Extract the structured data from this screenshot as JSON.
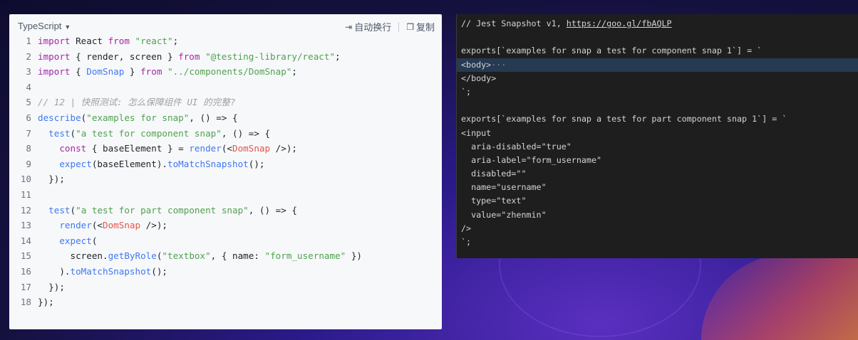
{
  "left_panel": {
    "language": "TypeScript",
    "wrap_label": "自动换行",
    "copy_label": "复制",
    "lines": [
      {
        "n": "1",
        "tokens": [
          {
            "t": "kw",
            "v": "import "
          },
          {
            "t": "tx",
            "v": "React "
          },
          {
            "t": "kw",
            "v": "from "
          },
          {
            "t": "str",
            "v": "\"react\""
          },
          {
            "t": "tx",
            "v": ";"
          }
        ]
      },
      {
        "n": "2",
        "tokens": [
          {
            "t": "kw",
            "v": "import "
          },
          {
            "t": "tx",
            "v": "{ render, screen } "
          },
          {
            "t": "kw",
            "v": "from "
          },
          {
            "t": "str",
            "v": "\"@testing-library/react\""
          },
          {
            "t": "tx",
            "v": ";"
          }
        ]
      },
      {
        "n": "3",
        "tokens": [
          {
            "t": "kw",
            "v": "import "
          },
          {
            "t": "tx",
            "v": "{ "
          },
          {
            "t": "fn",
            "v": "DomSnap"
          },
          {
            "t": "tx",
            "v": " } "
          },
          {
            "t": "kw",
            "v": "from "
          },
          {
            "t": "str",
            "v": "\"../components/DomSnap\""
          },
          {
            "t": "tx",
            "v": ";"
          }
        ]
      },
      {
        "n": "4",
        "tokens": []
      },
      {
        "n": "5",
        "tokens": [
          {
            "t": "cmt",
            "v": "// 12 | 快照测试: 怎么保障组件 UI 的完整?"
          }
        ]
      },
      {
        "n": "6",
        "tokens": [
          {
            "t": "fn",
            "v": "describe"
          },
          {
            "t": "tx",
            "v": "("
          },
          {
            "t": "str",
            "v": "\"examples for snap\""
          },
          {
            "t": "tx",
            "v": ", () => {"
          }
        ]
      },
      {
        "n": "7",
        "tokens": [
          {
            "t": "tx",
            "v": "  "
          },
          {
            "t": "fn",
            "v": "test"
          },
          {
            "t": "tx",
            "v": "("
          },
          {
            "t": "str",
            "v": "\"a test for component snap\""
          },
          {
            "t": "tx",
            "v": ", () => {"
          }
        ]
      },
      {
        "n": "8",
        "tokens": [
          {
            "t": "tx",
            "v": "    "
          },
          {
            "t": "kw",
            "v": "const "
          },
          {
            "t": "tx",
            "v": "{ baseElement } = "
          },
          {
            "t": "fn",
            "v": "render"
          },
          {
            "t": "tx",
            "v": "(<"
          },
          {
            "t": "tag",
            "v": "DomSnap"
          },
          {
            "t": "tx",
            "v": " />);"
          }
        ]
      },
      {
        "n": "9",
        "tokens": [
          {
            "t": "tx",
            "v": "    "
          },
          {
            "t": "fn",
            "v": "expect"
          },
          {
            "t": "tx",
            "v": "(baseElement)."
          },
          {
            "t": "fn",
            "v": "toMatchSnapshot"
          },
          {
            "t": "tx",
            "v": "();"
          }
        ]
      },
      {
        "n": "10",
        "tokens": [
          {
            "t": "tx",
            "v": "  });"
          }
        ]
      },
      {
        "n": "11",
        "tokens": []
      },
      {
        "n": "12",
        "tokens": [
          {
            "t": "tx",
            "v": "  "
          },
          {
            "t": "fn",
            "v": "test"
          },
          {
            "t": "tx",
            "v": "("
          },
          {
            "t": "str",
            "v": "\"a test for part component snap\""
          },
          {
            "t": "tx",
            "v": ", () => {"
          }
        ]
      },
      {
        "n": "13",
        "tokens": [
          {
            "t": "tx",
            "v": "    "
          },
          {
            "t": "fn",
            "v": "render"
          },
          {
            "t": "tx",
            "v": "(<"
          },
          {
            "t": "tag",
            "v": "DomSnap"
          },
          {
            "t": "tx",
            "v": " />);"
          }
        ]
      },
      {
        "n": "14",
        "tokens": [
          {
            "t": "tx",
            "v": "    "
          },
          {
            "t": "fn",
            "v": "expect"
          },
          {
            "t": "tx",
            "v": "("
          }
        ]
      },
      {
        "n": "15",
        "tokens": [
          {
            "t": "tx",
            "v": "      screen."
          },
          {
            "t": "fn",
            "v": "getByRole"
          },
          {
            "t": "tx",
            "v": "("
          },
          {
            "t": "str",
            "v": "\"textbox\""
          },
          {
            "t": "tx",
            "v": ", { name: "
          },
          {
            "t": "str",
            "v": "\"form_username\""
          },
          {
            "t": "tx",
            "v": " })"
          }
        ]
      },
      {
        "n": "16",
        "tokens": [
          {
            "t": "tx",
            "v": "    )."
          },
          {
            "t": "fn",
            "v": "toMatchSnapshot"
          },
          {
            "t": "tx",
            "v": "();"
          }
        ]
      },
      {
        "n": "17",
        "tokens": [
          {
            "t": "tx",
            "v": "  });"
          }
        ]
      },
      {
        "n": "18",
        "tokens": [
          {
            "t": "tx",
            "v": "});"
          }
        ]
      }
    ]
  },
  "right_panel": {
    "link": "https://goo.gl/fbAQLP",
    "lines": [
      {
        "text": "// Jest Snapshot v1, ",
        "link": true
      },
      {
        "text": ""
      },
      {
        "text": "exports[`examples for snap a test for component snap 1`] = `"
      },
      {
        "text": "<body>",
        "ellipsis": "···",
        "highlight": true
      },
      {
        "text": "</body>"
      },
      {
        "text": "`;"
      },
      {
        "text": ""
      },
      {
        "text": "exports[`examples for snap a test for part component snap 1`] = `"
      },
      {
        "text": "<input"
      },
      {
        "text": "  aria-disabled=\"true\""
      },
      {
        "text": "  aria-label=\"form_username\""
      },
      {
        "text": "  disabled=\"\""
      },
      {
        "text": "  name=\"username\""
      },
      {
        "text": "  type=\"text\""
      },
      {
        "text": "  value=\"zhenmin\""
      },
      {
        "text": "/>"
      },
      {
        "text": "`;"
      }
    ]
  }
}
